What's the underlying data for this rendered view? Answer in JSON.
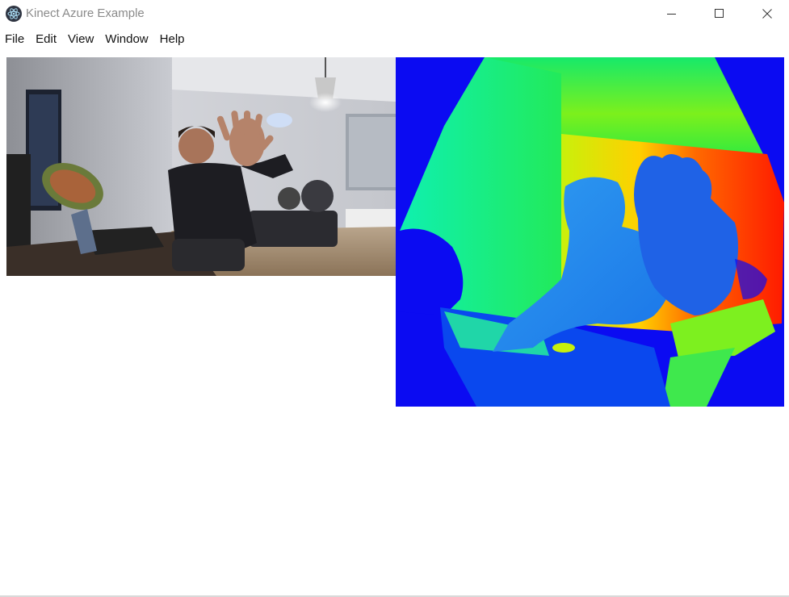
{
  "window": {
    "title": "Kinect Azure Example",
    "icon": "electron-app-icon",
    "controls": [
      "minimize-icon",
      "maximize-icon",
      "close-icon"
    ]
  },
  "menu": [
    {
      "label": "File"
    },
    {
      "label": "Edit"
    },
    {
      "label": "View"
    },
    {
      "label": "Window"
    },
    {
      "label": "Help"
    }
  ],
  "views": {
    "color": "color-camera-feed",
    "depth": "depth-map-feed"
  },
  "colors": {
    "depth_background": "#0b0bf2",
    "title_text": "#8a8a8a"
  }
}
